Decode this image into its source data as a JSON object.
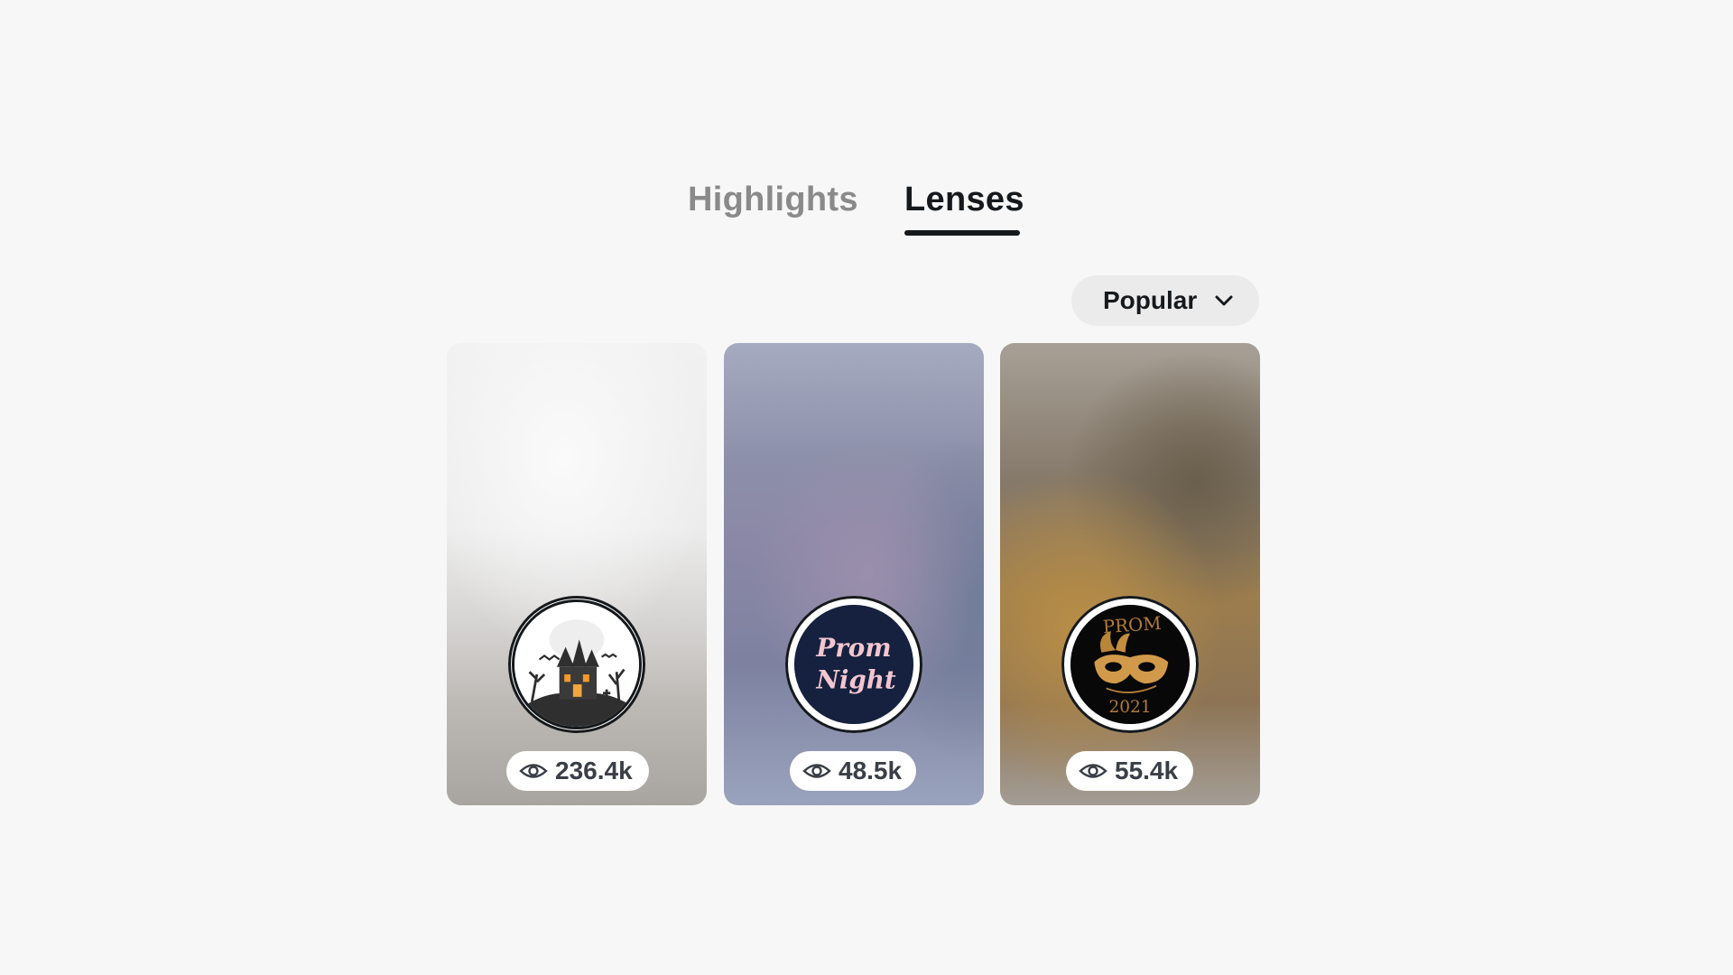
{
  "tabs": [
    {
      "label": "Highlights",
      "active": false
    },
    {
      "label": "Lenses",
      "active": true
    }
  ],
  "sort": {
    "selected": "Popular",
    "icon": "chevron-down-icon"
  },
  "lenses": [
    {
      "thumbnail": "haunted-house-icon",
      "views": "236.4k",
      "view_icon": "eye-icon"
    },
    {
      "thumbnail": "prom-night-icon",
      "thumbnail_text": "Prom Night",
      "views": "48.5k",
      "view_icon": "eye-icon"
    },
    {
      "thumbnail": "masquerade-mask-icon",
      "thumbnail_text": "PROM 2021",
      "views": "55.4k",
      "view_icon": "eye-icon"
    }
  ],
  "colors": {
    "text_primary": "#16191c",
    "text_inactive": "#8a8a8a",
    "background": "#f7f7f7",
    "chip": "#ebebeb"
  }
}
